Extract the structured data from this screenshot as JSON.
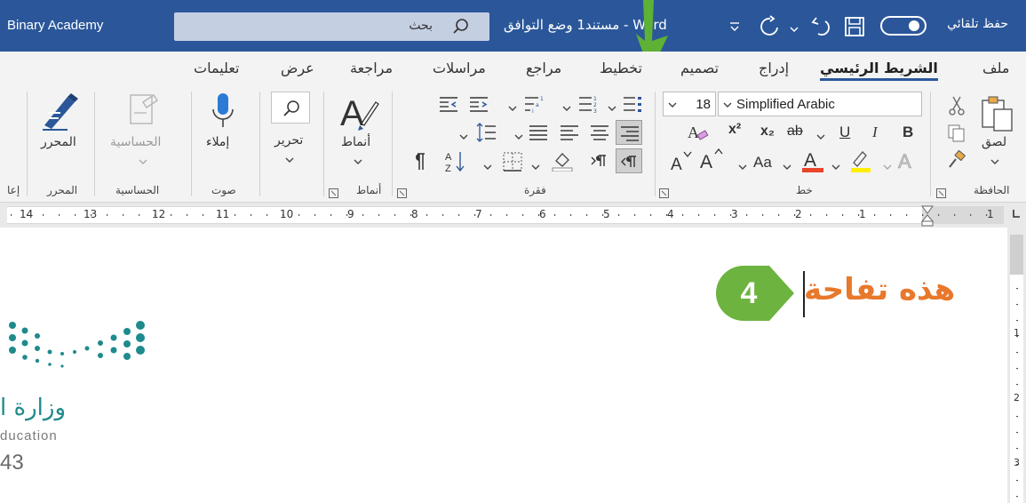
{
  "titlebar": {
    "user_name": "Binary Academy",
    "search_placeholder": "بحث",
    "doc_title": "Word  -  مستند1  وضع التوافق",
    "autosave_label": "حفظ تلقائي"
  },
  "tabs": [
    {
      "label": "ملف"
    },
    {
      "label": "الشريط الرئيسي",
      "active": true
    },
    {
      "label": "إدراج"
    },
    {
      "label": "تصميم"
    },
    {
      "label": "تخطيط"
    },
    {
      "label": "مراجع"
    },
    {
      "label": "مراسلات"
    },
    {
      "label": "مراجعة"
    },
    {
      "label": "عرض"
    },
    {
      "label": "تعليمات"
    }
  ],
  "ribbon": {
    "groups": {
      "clipboard": "الحافظة",
      "font": "خط",
      "paragraph": "فقرة",
      "styles": "أنماط",
      "voice": "صوت",
      "sensitivity": "الحساسية",
      "editor": "المحرر",
      "reuse": "إعا"
    },
    "paste_label": "لصق",
    "font_name": "Simplified Arabic",
    "font_size": "18",
    "styles_label": "أنماط",
    "editing_label": "تحرير",
    "dictate_label": "إملاء",
    "sensitivity_label": "الحساسية",
    "editor_label": "المحرر",
    "bold": "B",
    "italic": "I",
    "underline": "U",
    "superscript": "x²",
    "subscript": "x₂",
    "change_case": "Aa"
  },
  "ruler": {
    "numbers": [
      "14",
      "13",
      "12",
      "11",
      "10",
      "9",
      "8",
      "7",
      "6",
      "5",
      "4",
      "3",
      "2",
      "1",
      "1"
    ]
  },
  "vruler": {
    "numbers": [
      "1",
      "2",
      "3"
    ]
  },
  "document": {
    "text": "هذه تفاحة",
    "step_number": "4"
  },
  "logo": {
    "ar_text": "وزارة ا",
    "en_text": "ducation",
    "number": "43"
  },
  "colors": {
    "titlebar": "#2b579a",
    "text_orange": "#e8782b",
    "step_green": "#6cb33f",
    "arrow_green": "#5db135",
    "logo_teal": "#1f8a8c"
  }
}
